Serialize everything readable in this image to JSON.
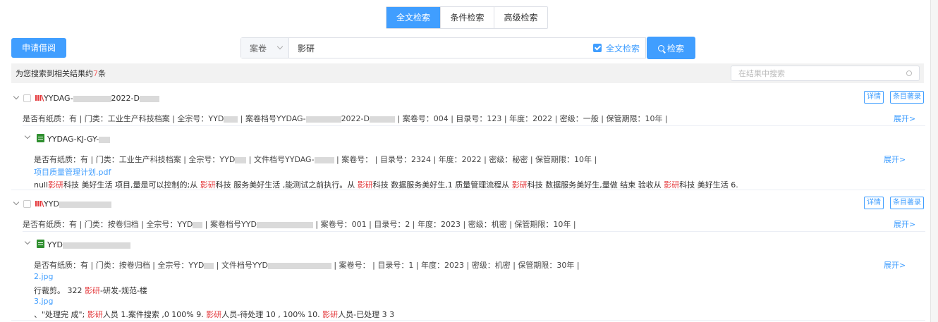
{
  "tabs": [
    {
      "label": "全文检索",
      "active": true
    },
    {
      "label": "条件检索",
      "active": false
    },
    {
      "label": "高级检索",
      "active": false
    }
  ],
  "apply_button": "申请借阅",
  "search": {
    "select_value": "案卷",
    "keyword": "影研",
    "fulltext_label": "全文检索",
    "button_label": "检索"
  },
  "result_bar": {
    "prefix": "为您搜索到相关结果约",
    "count": "7",
    "suffix": "条",
    "filter_placeholder": "在结果中搜索"
  },
  "labels": {
    "detail": "详情",
    "catalog": "条目著录",
    "expand": "展开>"
  },
  "records": [
    {
      "title_a": "YYDAG-",
      "title_b": "2022-D",
      "meta": {
        "p1": "是否有纸质：有 | 门类：工业生产科技档案 | 全宗号：YYD",
        "p2": " | 案卷档号YYDAG-",
        "p3": "2022-D",
        "p4": " | 案卷号：004 | 目录号：123 | 年度：2022 | 密级：一般 | 保管期限：10年 |"
      },
      "file": {
        "title": "YYDAG-KJ-GY-",
        "meta_a": "是否有纸质：有 | 门类：工业生产科技档案 | 全宗号：YYD",
        "meta_b": " | 文件档号YYDAG-",
        "meta_c": " | 案卷号：  | 目录号：2324 | 年度：2022 | 密级：秘密 | 保管期限：10年 |",
        "attachment": "项目质量管理计划.pdf",
        "snippet": [
          {
            "t": "null",
            "h": false
          },
          {
            "t": "影研",
            "h": true
          },
          {
            "t": "科技 美好生活 项目,量是可以控制的;从 ",
            "h": false
          },
          {
            "t": "影研",
            "h": true
          },
          {
            "t": "科技 服务美好生活 ,能测试之前执行。从 ",
            "h": false
          },
          {
            "t": "影研",
            "h": true
          },
          {
            "t": "科技 数据服务美好生,1 质量管理流程从 ",
            "h": false
          },
          {
            "t": "影研",
            "h": true
          },
          {
            "t": "科技 数据服务美好生,量做 结束 验收从 ",
            "h": false
          },
          {
            "t": "影研",
            "h": true
          },
          {
            "t": "科技 美好生活 6.",
            "h": false
          }
        ]
      }
    },
    {
      "title_a": "YYD",
      "meta": {
        "p1": "是否有纸质：有 | 门类：按卷归档 | 全宗号：YYD",
        "p2": " | 案卷档号YYD",
        "p4": " | 案卷号：001 | 目录号：2 | 年度：2023 | 密级：机密 | 保管期限：10年 |"
      },
      "file": {
        "title": "YYD",
        "meta_a": "是否有纸质：有 | 门类：按卷归档 | 全宗号：YYD",
        "meta_b": " | 文件档号YYD",
        "meta_c": " | 案卷号：  | 目录号：1 | 年度：2023 | 密级：机密 | 保管期限：30年 |",
        "attachment_1": "2.jpg",
        "snippet_1": [
          {
            "t": "行裁剪。 322 ",
            "h": false
          },
          {
            "t": "影研",
            "h": true
          },
          {
            "t": "-研发-规范-楼",
            "h": false
          }
        ],
        "attachment_2": "3.jpg",
        "snippet_2": [
          {
            "t": "、\"处理完 成\"; ",
            "h": false
          },
          {
            "t": "影研",
            "h": true
          },
          {
            "t": "人员 1.案件搜索 ,0 100% 9. ",
            "h": false
          },
          {
            "t": "影研",
            "h": true
          },
          {
            "t": "人员-待处理 10 , 100% 10. ",
            "h": false
          },
          {
            "t": "影研",
            "h": true
          },
          {
            "t": "人员-已处理 3 3",
            "h": false
          }
        ]
      }
    }
  ]
}
